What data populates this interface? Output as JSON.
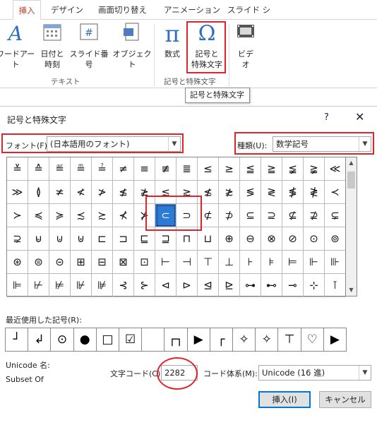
{
  "ribbon": {
    "tabs": [
      {
        "label": "挿入",
        "active": true
      },
      {
        "label": "デザイン",
        "active": false
      },
      {
        "label": "画面切り替え",
        "active": false
      },
      {
        "label": "アニメーション",
        "active": false
      },
      {
        "label": "スライド シ",
        "active": false
      }
    ],
    "tools": {
      "wordart": {
        "label": "ワードアート",
        "icon": "wordart-icon"
      },
      "datetime": {
        "label1": "日付と",
        "label2": "時刻",
        "icon": "calendar-icon"
      },
      "slide_number": {
        "label": "スライド番号",
        "icon": "hash-icon"
      },
      "object": {
        "label": "オブジェクト",
        "icon": "object-icon"
      },
      "equation": {
        "label": "数式",
        "icon": "pi-icon"
      },
      "symbol": {
        "label1": "記号と",
        "label2": "特殊文字",
        "icon": "omega-icon"
      },
      "video": {
        "label": "ビデオ",
        "icon": "film-icon"
      }
    },
    "groups": {
      "text": "テキスト",
      "symbols": "記号と特殊文字"
    },
    "tooltip": "記号と特殊文字"
  },
  "dialog": {
    "title": "記号と特殊文字",
    "help": "?",
    "close": "✕",
    "font_label": "フォント(F):",
    "font_value": "(日本語用のフォント)",
    "subset_label": "種類(U):",
    "subset_value": "数学記号",
    "symbols": [
      [
        "≚",
        "≙",
        "≝",
        "≞",
        "≟",
        "≠",
        "≡",
        "≢",
        "≣",
        "≤",
        "≥",
        "≦",
        "≧",
        "≨",
        "≩",
        "≪"
      ],
      [
        "≫",
        "≬",
        "≭",
        "≮",
        "≯",
        "≰",
        "≱",
        "≲",
        "≳",
        "≴",
        "≵",
        "≶",
        "≷",
        "≸",
        "≹",
        "≺"
      ],
      [
        "≻",
        "≼",
        "≽",
        "≾",
        "≿",
        "⊀",
        "⊁",
        "⊂",
        "⊃",
        "⊄",
        "⊅",
        "⊆",
        "⊇",
        "⊈",
        "⊉",
        "⊊"
      ],
      [
        "⊋",
        "⊌",
        "⊍",
        "⊎",
        "⊏",
        "⊐",
        "⊑",
        "⊒",
        "⊓",
        "⊔",
        "⊕",
        "⊖",
        "⊗",
        "⊘",
        "⊙",
        "⊚"
      ],
      [
        "⊛",
        "⊜",
        "⊝",
        "⊞",
        "⊟",
        "⊠",
        "⊡",
        "⊢",
        "⊣",
        "⊤",
        "⊥",
        "⊦",
        "⊧",
        "⊨",
        "⊩",
        "⊪"
      ],
      [
        "⊫",
        "⊬",
        "⊭",
        "⊮",
        "⊯",
        "⊰",
        "⊱",
        "⊲",
        "⊳",
        "⊴",
        "⊵",
        "⊶",
        "⊷",
        "⊸",
        "⊹",
        "⊺"
      ]
    ],
    "selected_symbol": "⊂",
    "recent_label": "最近使用した記号(R):",
    "recent": [
      "┘",
      "↲",
      "⊙",
      "●",
      "□",
      "☑",
      "",
      "┌┐",
      "▶",
      "┌",
      "✧",
      "✧",
      "⊤",
      "♡",
      "▶"
    ],
    "unicode_name_label": "Unicode 名:",
    "subset_of_label": "Subset Of",
    "char_code_label": "文字コード(C):",
    "char_code_value": "2282",
    "from_label": "コード体系(M):",
    "from_value": "Unicode (16 進)",
    "insert_button": "挿入(I)",
    "cancel_button": "キャンセル"
  }
}
